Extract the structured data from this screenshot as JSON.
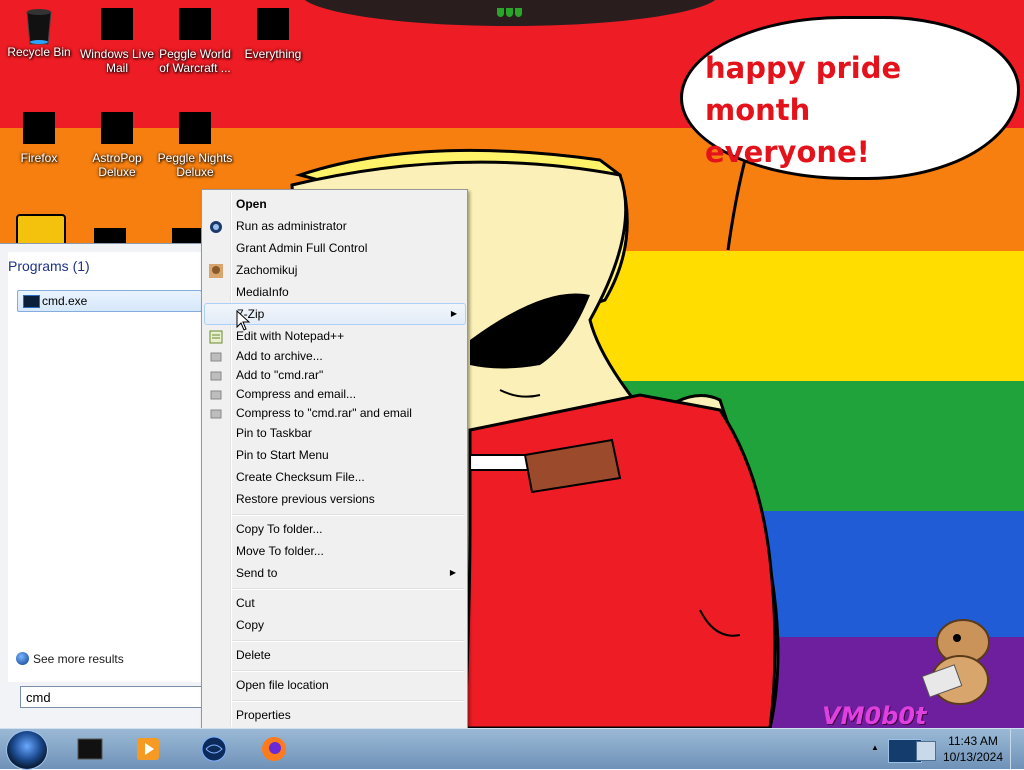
{
  "desktop": {
    "icons": [
      {
        "label": "Recycle Bin"
      },
      {
        "label": "Windows Live Mail"
      },
      {
        "label": "Peggle World of Warcraft ..."
      },
      {
        "label": "Everything"
      },
      {
        "label": "Firefox"
      },
      {
        "label": "AstroPop Deluxe"
      },
      {
        "label": "Peggle Nights Deluxe"
      }
    ],
    "bubble_text": "happy pride month everyone!",
    "watermark": "VM0b0t",
    "stripe_colors": [
      "#ee1c24",
      "#f77f0f",
      "#ffdd00",
      "#1fa33a",
      "#1f5cd6",
      "#6d1f9e"
    ]
  },
  "start_menu": {
    "section_header": "Programs (1)",
    "program_item": "cmd.exe",
    "see_more": "See more results",
    "search_value": "cmd"
  },
  "context_menu": {
    "items": [
      {
        "label": "Open",
        "bold": true
      },
      {
        "label": "Run as administrator",
        "icon": "shield-icon"
      },
      {
        "label": "Grant Admin Full Control"
      },
      {
        "label": "Zachomikuj",
        "icon": "hamster-icon"
      },
      {
        "label": "MediaInfo"
      },
      {
        "label": "7-Zip",
        "submenu": true
      },
      {
        "label": "Edit with Notepad++",
        "icon": "notepadpp-icon"
      },
      {
        "label": "Add to archive...",
        "icon": "winrar-icon"
      },
      {
        "label": "Add to \"cmd.rar\"",
        "icon": "winrar-icon"
      },
      {
        "label": "Compress and email...",
        "icon": "winrar-icon"
      },
      {
        "label": "Compress to \"cmd.rar\" and email",
        "icon": "winrar-icon"
      },
      {
        "label": "Pin to Taskbar"
      },
      {
        "label": "Pin to Start Menu"
      },
      {
        "label": "Create Checksum File..."
      },
      {
        "label": "Restore previous versions"
      },
      {
        "label": "Copy To folder..."
      },
      {
        "label": "Move To folder..."
      },
      {
        "label": "Send to",
        "submenu": true
      },
      {
        "label": "Cut"
      },
      {
        "label": "Copy"
      },
      {
        "label": "Delete"
      },
      {
        "label": "Open file location"
      },
      {
        "label": "Properties"
      }
    ]
  },
  "taskbar": {
    "time": "11:43 AM",
    "date": "10/13/2024",
    "pinned": [
      "terminal-icon",
      "media-player-icon",
      "browser-globe-icon",
      "firefox-icon"
    ]
  }
}
